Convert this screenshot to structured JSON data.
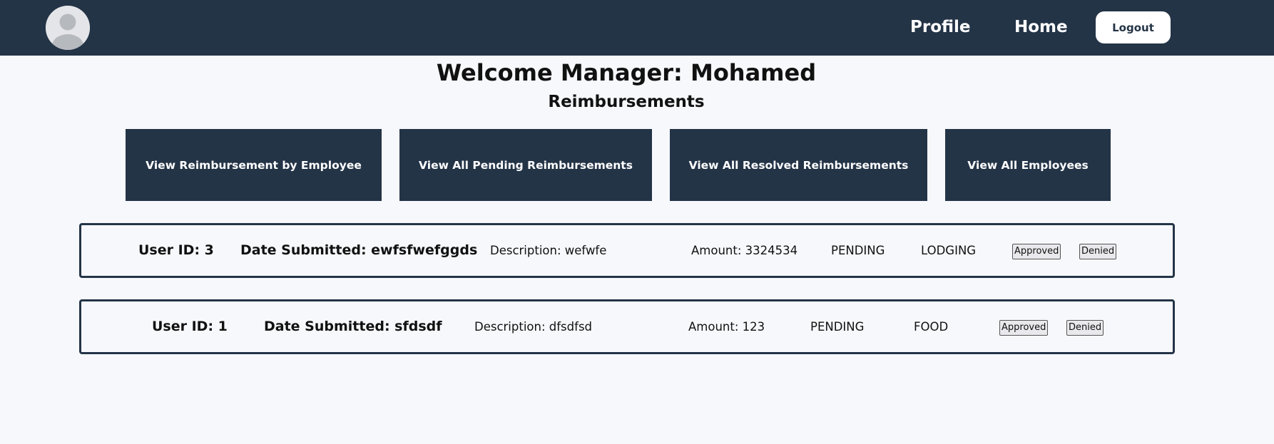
{
  "nav": {
    "profile_label": "Profile",
    "home_label": "Home",
    "logout_label": "Logout"
  },
  "header": {
    "welcome": "Welcome Manager: Mohamed",
    "subtitle": "Reimbursements"
  },
  "actions": [
    "View Reimbursement by Employee",
    "View All Pending Reimbursements",
    "View All Resolved Reimbursements",
    "View All Employees"
  ],
  "reimbursements": [
    {
      "user_id": "User ID: 3",
      "date_submitted": "Date Submitted: ewfsfwefggds",
      "description": "Description: wefwfe",
      "amount": "Amount: 3324534",
      "status": "PENDING",
      "type": "LODGING",
      "approve_label": "Approved",
      "deny_label": "Denied"
    },
    {
      "user_id": "User ID: 1",
      "date_submitted": "Date Submitted: sfdsdf",
      "description": "Description: dfsdfsd",
      "amount": "Amount: 123",
      "status": "PENDING",
      "type": "FOOD",
      "approve_label": "Approved",
      "deny_label": "Denied"
    }
  ],
  "icons": {
    "avatar": "user-avatar-icon"
  },
  "colors": {
    "navbar": "#243447",
    "background": "#f7f8fc"
  }
}
